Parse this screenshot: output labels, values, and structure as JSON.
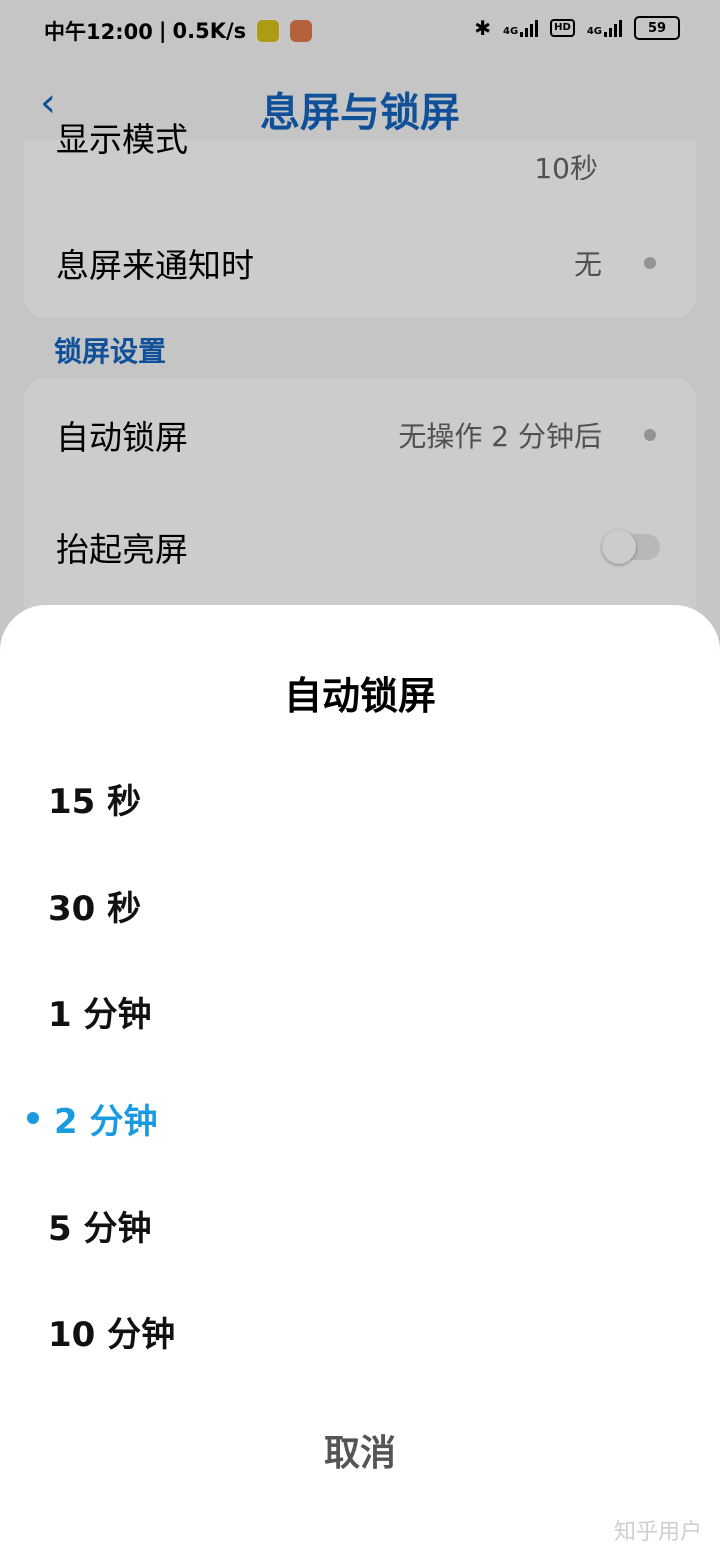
{
  "status_bar": {
    "time": "中午12:00",
    "speed": "0.5K/s",
    "net1": "4G",
    "hd": "HD",
    "net2": "4G",
    "battery": "59",
    "icons": [
      "qq-music-icon",
      "health-app-icon",
      "bluetooth-icon",
      "signal-icon",
      "hd-icon",
      "signal-icon",
      "battery-icon"
    ]
  },
  "header": {
    "title": "息屏与锁屏",
    "back_icon": "chevron-left-icon"
  },
  "aod_card": {
    "display_mode_label": "显示模式",
    "display_mode_value": "10秒",
    "notify_label": "息屏来通知时",
    "notify_value": "无"
  },
  "lock_section": {
    "title": "锁屏设置",
    "auto_lock_label": "自动锁屏",
    "auto_lock_value": "无操作 2 分钟后",
    "raise_to_wake_label": "抬起亮屏",
    "raise_to_wake_on": false
  },
  "sheet": {
    "title": "自动锁屏",
    "options": [
      "15 秒",
      "30 秒",
      "1 分钟",
      "2 分钟",
      "5 分钟",
      "10 分钟"
    ],
    "selected": "2 分钟",
    "cancel": "取消"
  },
  "watermark": "知乎用户",
  "colors": {
    "accent": "#1565c0",
    "selected": "#1a9be0"
  }
}
